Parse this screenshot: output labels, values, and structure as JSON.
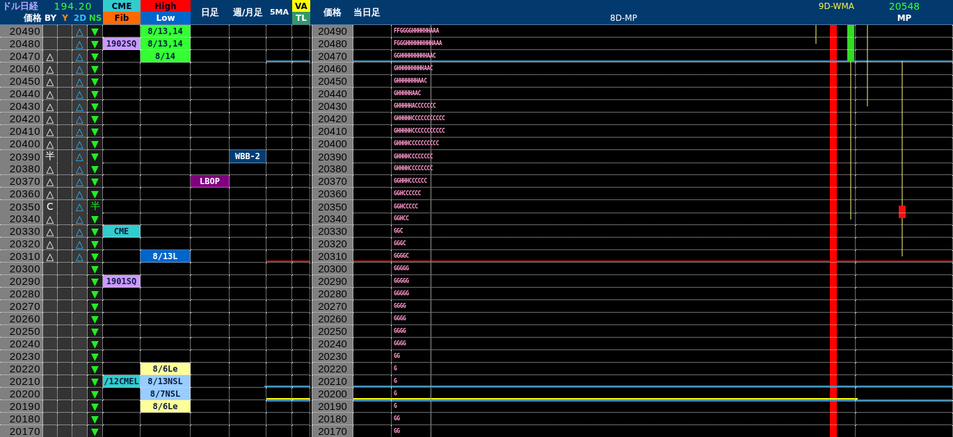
{
  "header": {
    "title": "ドル日経",
    "rate": "194.20",
    "price_label": "価格",
    "by": "BY",
    "y": "Y",
    "d2": "2D",
    "ns": "NS",
    "cme": "CME",
    "fib": "Fib",
    "high": "High",
    "low": "Low",
    "daily": "日足",
    "weekly_monthly": "週/月足",
    "ma5": "5MA",
    "va": "VA",
    "tl": "TL",
    "price_label_2": "価格",
    "today": "当日足",
    "wma": "9D-WMA",
    "profile": "8D-MP",
    "mp_value": "20548",
    "mp": "MP"
  },
  "rows": [
    {
      "price": "20490",
      "d2": "△",
      "ns": "▼",
      "high_low": {
        "text": "8/13,14",
        "color": "#33ff33"
      },
      "price_2": "20490",
      "tpo": "FFGGGGHHHHHHAAA"
    },
    {
      "price": "20480",
      "d2": "△",
      "ns": "▼",
      "cme_fib": {
        "text": "1902SQ",
        "color": "#cc99ff"
      },
      "high_low": {
        "text": "8/13,14",
        "color": "#33ff33"
      },
      "price_2": "20480",
      "tpo": "FGGGHHHHHHHHHAAA"
    },
    {
      "price": "20470",
      "by": "△",
      "d2": "△",
      "ns": "▼",
      "high_low": {
        "text": "8/14",
        "color": "#33ff33"
      },
      "price_2": "20470",
      "tpo": "GGHHHHHHHHHAAC"
    },
    {
      "price": "20460",
      "by": "△",
      "d2": "△",
      "ns": "▼",
      "price_2": "20460",
      "tpo": "GHHHHHHHHHAAC"
    },
    {
      "price": "20450",
      "by": "△",
      "d2": "△",
      "ns": "▼",
      "price_2": "20450",
      "tpo": "GHHHHHHHAAC"
    },
    {
      "price": "20440",
      "by": "△",
      "d2": "△",
      "ns": "▼",
      "price_2": "20440",
      "tpo": "GHHHHHAAC"
    },
    {
      "price": "20430",
      "by": "△",
      "d2": "△",
      "ns": "▼",
      "price_2": "20430",
      "tpo": "GHHHHHACCCCCCC"
    },
    {
      "price": "20420",
      "by": "△",
      "d2": "△",
      "ns": "▼",
      "price_2": "20420",
      "tpo": "GHHHHHCCCCCCCCCCC"
    },
    {
      "price": "20410",
      "by": "△",
      "d2": "△",
      "ns": "▼",
      "price_2": "20410",
      "tpo": "GHHHHHCCCCCCCCCCC"
    },
    {
      "price": "20400",
      "by": "△",
      "d2": "△",
      "ns": "▼",
      "price_2": "20400",
      "tpo": "GHHHHCCCCCCCCCC"
    },
    {
      "price": "20390",
      "by": "半",
      "d2": "△",
      "ns": "▼",
      "weekly_monthly": {
        "text": "WBB-2",
        "color": "#003d73"
      },
      "price_2": "20390",
      "tpo": "GHHHHCCCCCCCC"
    },
    {
      "price": "20380",
      "by": "△",
      "d2": "△",
      "ns": "▼",
      "price_2": "20380",
      "tpo": "GHHHHCCCCCCCC"
    },
    {
      "price": "20370",
      "by": "△",
      "d2": "△",
      "ns": "▼",
      "daily": {
        "text": "LBOP",
        "color": "#800080"
      },
      "price_2": "20370",
      "tpo": "GGHHHCCCCCC"
    },
    {
      "price": "20360",
      "by": "△",
      "d2": "△",
      "ns": "▼",
      "price_2": "20360",
      "tpo": "GGHCCCCCC"
    },
    {
      "price": "20350",
      "by": "C",
      "d2": "△",
      "ns": "半",
      "price_2": "20350",
      "tpo": "GGHCCCCC"
    },
    {
      "price": "20340",
      "by": "△",
      "d2": "△",
      "ns": "▼",
      "price_2": "20340",
      "tpo": "GGHCC"
    },
    {
      "price": "20330",
      "by": "△",
      "d2": "△",
      "ns": "▼",
      "cme_fib": {
        "text": "CME",
        "color": "#33cccc"
      },
      "price_2": "20330",
      "tpo": "GGC"
    },
    {
      "price": "20320",
      "by": "△",
      "d2": "△",
      "ns": "▼",
      "price_2": "20320",
      "tpo": "GGGC"
    },
    {
      "price": "20310",
      "by": "△",
      "d2": "△",
      "ns": "▼",
      "high_low": {
        "text": "8/13L",
        "color": "#0066cc"
      },
      "price_2": "20310",
      "tpo": "GGGGC"
    },
    {
      "price": "20300",
      "ns": "▼",
      "price_2": "20300",
      "tpo": "GGGGG"
    },
    {
      "price": "20290",
      "ns": "▼",
      "cme_fib": {
        "text": "1901SQ",
        "color": "#cc99ff"
      },
      "price_2": "20290",
      "tpo": "GGGGG"
    },
    {
      "price": "20280",
      "ns": "▼",
      "price_2": "20280",
      "tpo": "GGGGG"
    },
    {
      "price": "20270",
      "ns": "▼",
      "price_2": "20270",
      "tpo": "GGGG"
    },
    {
      "price": "20260",
      "ns": "▼",
      "price_2": "20260",
      "tpo": "GGGG"
    },
    {
      "price": "20250",
      "ns": "▼",
      "price_2": "20250",
      "tpo": "GGGG"
    },
    {
      "price": "20240",
      "ns": "▼",
      "price_2": "20240",
      "tpo": "GGGG"
    },
    {
      "price": "20230",
      "ns": "▼",
      "price_2": "20230",
      "tpo": "GG"
    },
    {
      "price": "20220",
      "ns": "▼",
      "high_low": {
        "text": "8/6Le",
        "color": "#ffff99"
      },
      "price_2": "20220",
      "tpo": "G"
    },
    {
      "price": "20210",
      "ns": "▼",
      "cme_fib": {
        "text": "/12CMEL",
        "color": "#33cccc"
      },
      "high_low": {
        "text": "8/13NSL",
        "color": "#99ccff"
      },
      "price_2": "20210",
      "tpo": "G"
    },
    {
      "price": "20200",
      "ns": "▼",
      "high_low": {
        "text": "8/7NSL",
        "color": "#99ccff"
      },
      "price_2": "20200",
      "tpo": "G"
    },
    {
      "price": "20190",
      "ns": "▼",
      "high_low": {
        "text": "8/6Le",
        "color": "#ffff99"
      },
      "price_2": "20190",
      "tpo": "G"
    },
    {
      "price": "20180",
      "ns": "▼",
      "price_2": "20180",
      "tpo": "GG"
    },
    {
      "price": "20170",
      "ns": "▼",
      "price_2": "20170",
      "tpo": "GG"
    }
  ]
}
